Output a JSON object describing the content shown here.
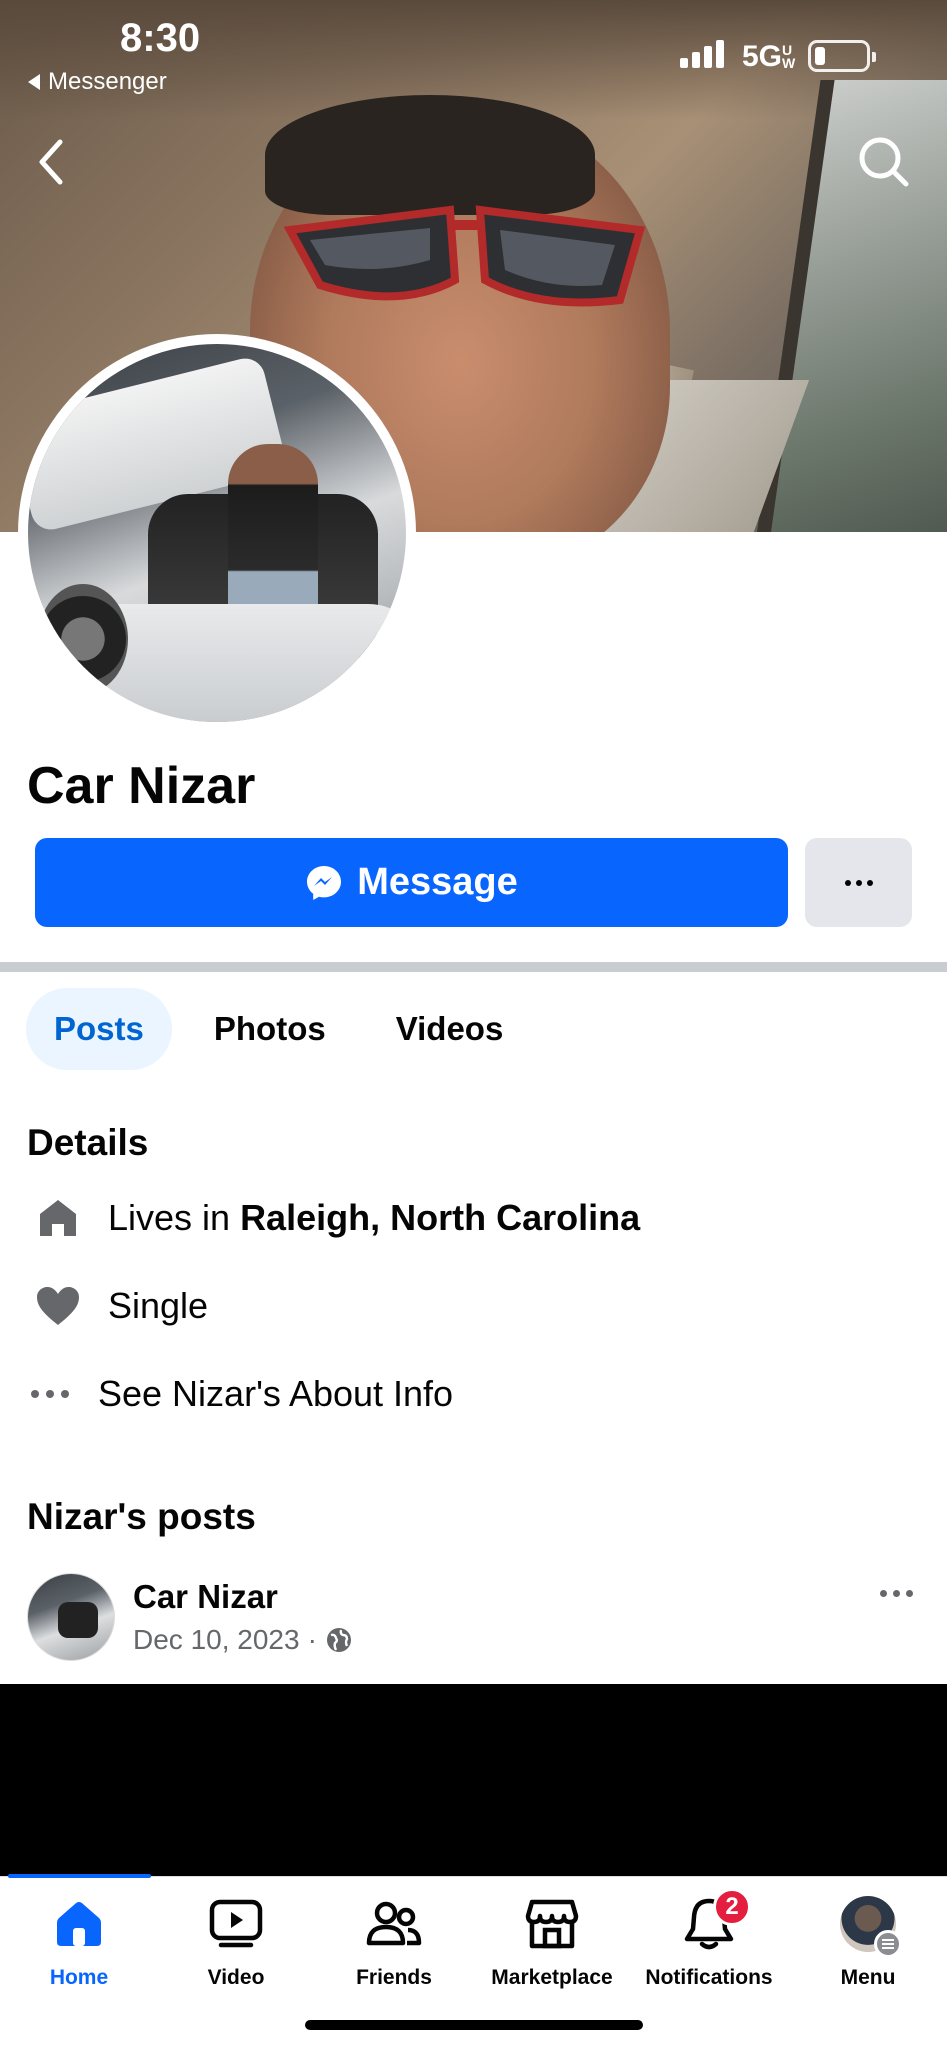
{
  "status_bar": {
    "time": "8:30",
    "back_app": "Messenger",
    "network": "5G",
    "network_suffix": "UW",
    "battery_level": 0.2
  },
  "profile": {
    "name": "Car Nizar",
    "message_button": "Message"
  },
  "tabs": [
    {
      "label": "Posts",
      "active": true
    },
    {
      "label": "Photos",
      "active": false
    },
    {
      "label": "Videos",
      "active": false
    }
  ],
  "details": {
    "title": "Details",
    "lives_prefix": "Lives in",
    "lives_location": "Raleigh, North Carolina",
    "relationship": "Single",
    "about_link": "See Nizar's About Info"
  },
  "posts": {
    "title": "Nizar's posts",
    "items": [
      {
        "author": "Car Nizar",
        "date": "Dec 10, 2023",
        "separator": "·",
        "audience_icon": "globe-icon"
      }
    ]
  },
  "bottom_nav": {
    "items": [
      {
        "label": "Home",
        "icon": "home-icon",
        "active": true
      },
      {
        "label": "Video",
        "icon": "video-icon",
        "active": false
      },
      {
        "label": "Friends",
        "icon": "friends-icon",
        "active": false
      },
      {
        "label": "Marketplace",
        "icon": "marketplace-icon",
        "active": false
      },
      {
        "label": "Notifications",
        "icon": "bell-icon",
        "active": false,
        "badge": "2"
      },
      {
        "label": "Menu",
        "icon": "avatar",
        "active": false
      }
    ]
  },
  "colors": {
    "accent": "#0866ff",
    "badge": "#e41e3f",
    "tab_active_bg": "#ebf5ff",
    "secondary_text": "#65676b"
  }
}
